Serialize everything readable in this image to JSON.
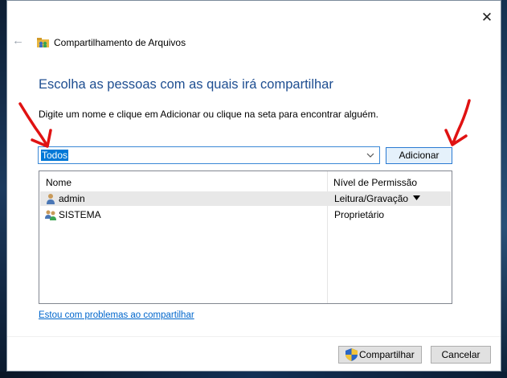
{
  "window": {
    "title": "Compartilhamento de Arquivos",
    "close_glyph": "✕",
    "back_glyph": "←"
  },
  "dialog": {
    "heading": "Escolha as pessoas com as quais irá compartilhar",
    "instruction": "Digite um nome e clique em Adicionar ou clique na seta para encontrar alguém.",
    "combo_value": "Todos",
    "add_button": "Adicionar"
  },
  "list": {
    "columns": [
      "Nome",
      "Nível de Permissão"
    ],
    "rows": [
      {
        "name": "admin",
        "permission": "Leitura/Gravação",
        "icon": "user-icon",
        "has_dropdown": true,
        "selected": true
      },
      {
        "name": "SISTEMA",
        "permission": "Proprietário",
        "icon": "group-icon",
        "has_dropdown": false,
        "selected": false
      }
    ]
  },
  "help_link": "Estou com problemas ao compartilhar",
  "footer": {
    "share_button": "Compartilhar",
    "cancel_button": "Cancelar"
  },
  "colors": {
    "heading": "#1e4e91",
    "link": "#0066cc",
    "selection": "#0078d7",
    "annotation_arrow": "#e01212"
  },
  "icons": [
    "back-arrow-icon",
    "share-folder-icon",
    "chevron-down-icon",
    "user-icon",
    "group-icon",
    "uac-shield-icon",
    "close-icon"
  ]
}
